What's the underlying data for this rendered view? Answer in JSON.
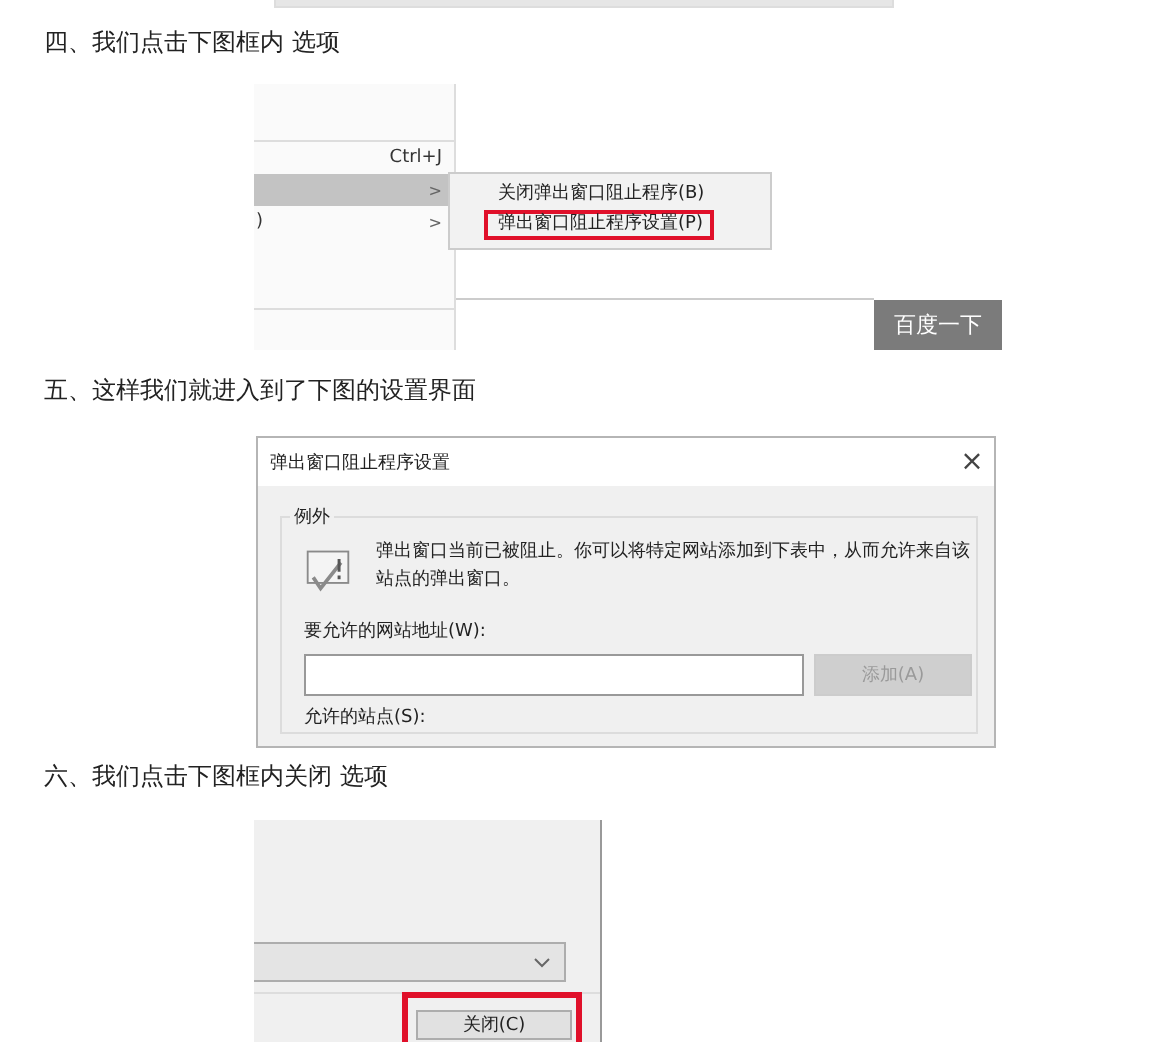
{
  "step4": {
    "heading": "四、我们点击下图框内 选项",
    "menu": [
      {
        "shortcut": "Ctrl+J",
        "highlighted": false
      },
      {
        "arrow": ">",
        "highlighted": true
      },
      {
        "label": ")",
        "arrow": ">",
        "highlighted": false
      }
    ],
    "submenu": [
      {
        "label": "关闭弹出窗口阻止程序(B)",
        "outlined": false
      },
      {
        "label": "弹出窗口阻止程序设置(P)",
        "outlined": true
      }
    ],
    "search_button": "百度一下"
  },
  "step5": {
    "heading": "五、这样我们就进入到了下图的设置界面",
    "dialog": {
      "title": "弹出窗口阻止程序设置",
      "close": "×",
      "group": "例外",
      "message": "弹出窗口当前已被阻止。你可以将特定网站添加到下表中，从而允许来自该站点的弹出窗口。",
      "url_label": "要允许的网站地址(W):",
      "add_button": {
        "label": "添加(A)",
        "disabled": true
      },
      "list_label": "允许的站点(S):"
    }
  },
  "step6": {
    "heading": "六、我们点击下图框内关闭 选项",
    "close_button": {
      "label": "关闭(C)",
      "outlined": true
    }
  }
}
